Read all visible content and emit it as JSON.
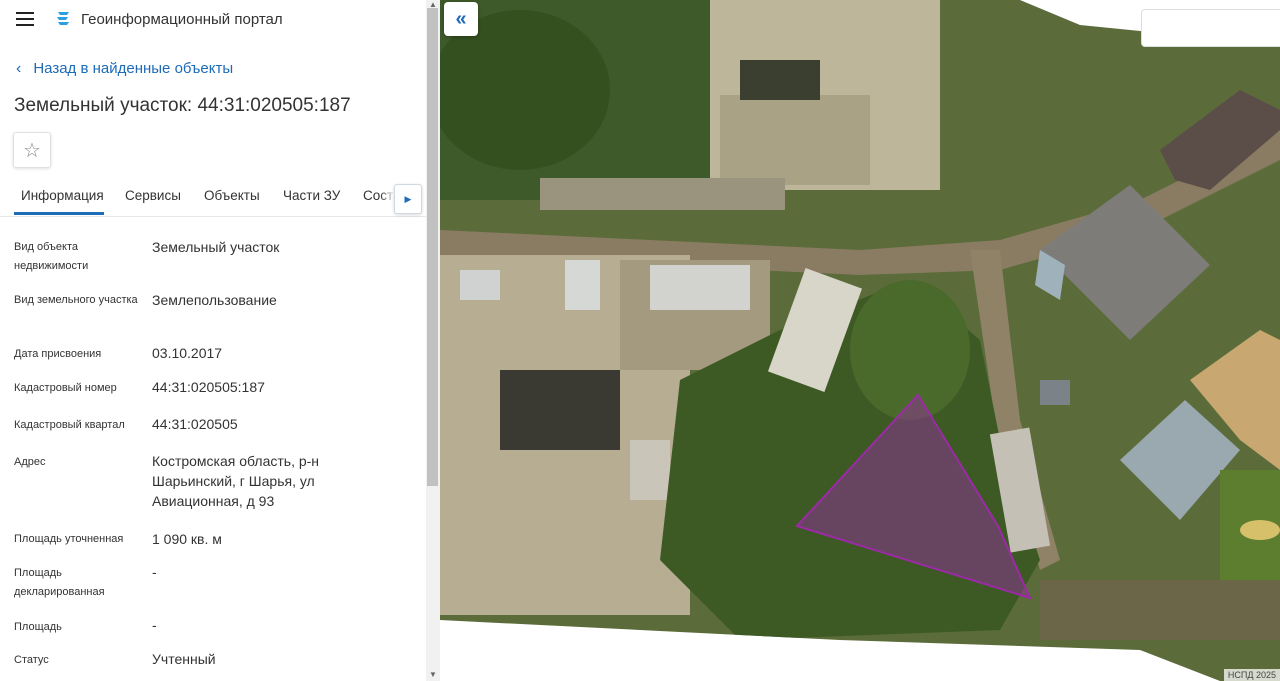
{
  "header": {
    "app_title": "Геоинформационный портал"
  },
  "navigation": {
    "back_label": "Назад в найденные объекты"
  },
  "object": {
    "title": "Земельный участок: 44:31:020505:187"
  },
  "tabs": [
    {
      "label": "Информация",
      "active": true
    },
    {
      "label": "Сервисы",
      "active": false
    },
    {
      "label": "Объекты",
      "active": false
    },
    {
      "label": "Части ЗУ",
      "active": false
    },
    {
      "label": "Соста",
      "active": false
    }
  ],
  "properties": [
    {
      "label": "Вид объекта недвижимости",
      "value": "Земельный участок"
    },
    {
      "label": "Вид земельного участка",
      "value": "Землепользование"
    },
    {
      "label": "Дата присвоения",
      "value": "03.10.2017"
    },
    {
      "label": "Кадастровый номер",
      "value": "44:31:020505:187"
    },
    {
      "label": "Кадастровый квартал",
      "value": "44:31:020505"
    },
    {
      "label": "Адрес",
      "value": "Костромская область, р-н Шарьинский, г Шарья, ул Авиационная, д 93"
    },
    {
      "label": "Площадь уточненная",
      "value": "1 090 кв. м"
    },
    {
      "label": "Площадь декларированная",
      "value": "-"
    },
    {
      "label": "Площадь",
      "value": "-"
    },
    {
      "label": "Статус",
      "value": "Учтенный"
    }
  ],
  "map": {
    "attribution": "НСПД 2025",
    "parcel_color": "#9c2aa6"
  },
  "colors": {
    "accent": "#1e6bb8"
  }
}
